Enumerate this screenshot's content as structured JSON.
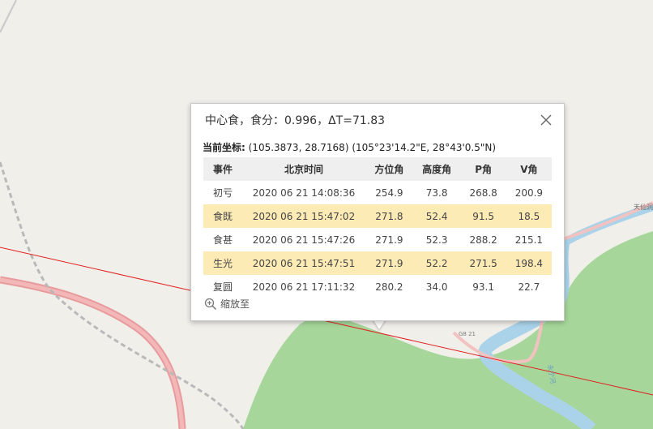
{
  "popup": {
    "title": "中心食，食分：0.996，ΔT=71.83",
    "coord_label": "当前坐标:",
    "coord_value": " (105.3873, 28.7168) (105°23'14.2\"E, 28°43'0.5\"N)",
    "columns": [
      "事件",
      "北京时间",
      "方位角",
      "高度角",
      "P角",
      "V角"
    ],
    "rows": [
      {
        "event": "初亏",
        "time": "2020 06 21 14:08:36",
        "azimuth": "254.9",
        "altitude": "73.8",
        "p": "268.8",
        "v": "200.9",
        "highlight": false
      },
      {
        "event": "食既",
        "time": "2020 06 21 15:47:02",
        "azimuth": "271.8",
        "altitude": "52.4",
        "p": "91.5",
        "v": "18.5",
        "highlight": true
      },
      {
        "event": "食甚",
        "time": "2020 06 21 15:47:26",
        "azimuth": "271.9",
        "altitude": "52.3",
        "p": "288.2",
        "v": "215.1",
        "highlight": false
      },
      {
        "event": "生光",
        "time": "2020 06 21 15:47:51",
        "azimuth": "271.9",
        "altitude": "52.2",
        "p": "271.5",
        "v": "198.4",
        "highlight": true
      },
      {
        "event": "复圆",
        "time": "2020 06 21 17:11:32",
        "azimuth": "280.2",
        "altitude": "34.0",
        "p": "93.1",
        "v": "22.7",
        "highlight": false
      }
    ],
    "zoom_label": "缩放至"
  },
  "map": {
    "road_label_g": "G8 21",
    "place_label": "天仙洞",
    "river_label": "永宁河",
    "colors": {
      "background": "#f1efea",
      "forest": "#a6d69a",
      "river": "#aad3ea",
      "highway": "#e79b9d",
      "eclipse_line": "#e02020"
    }
  }
}
